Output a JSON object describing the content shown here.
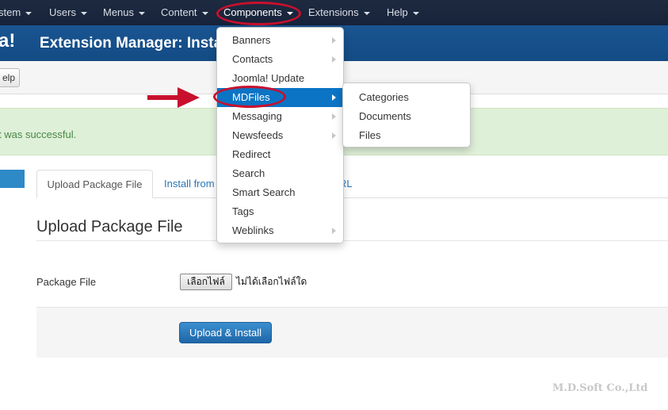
{
  "nav": {
    "items": [
      {
        "label": "stem"
      },
      {
        "label": "Users"
      },
      {
        "label": "Menus"
      },
      {
        "label": "Content"
      },
      {
        "label": "Components"
      },
      {
        "label": "Extensions"
      },
      {
        "label": "Help"
      }
    ]
  },
  "header": {
    "logo": "a!",
    "title": "Extension Manager: Insta"
  },
  "toolbar": {
    "help_label": "elp"
  },
  "alert": {
    "message": "t was successful."
  },
  "tabs": {
    "upload_label": "Upload Package File",
    "install_from_label": "Install from",
    "url_label": "RL"
  },
  "section": {
    "title": "Upload Package File",
    "package_label": "Package File",
    "file_button": "เลือกไฟล์",
    "file_status": "ไม่ได้เลือกไฟล์ใด",
    "submit_label": "Upload & Install"
  },
  "dropdown": {
    "items": [
      {
        "label": "Banners",
        "submenu": true
      },
      {
        "label": "Contacts",
        "submenu": true
      },
      {
        "label": "Joomla! Update",
        "submenu": false
      },
      {
        "label": "MDFiles",
        "submenu": true,
        "highlighted": true
      },
      {
        "label": "Messaging",
        "submenu": true
      },
      {
        "label": "Newsfeeds",
        "submenu": true
      },
      {
        "label": "Redirect",
        "submenu": false
      },
      {
        "label": "Search",
        "submenu": false
      },
      {
        "label": "Smart Search",
        "submenu": false
      },
      {
        "label": "Tags",
        "submenu": false
      },
      {
        "label": "Weblinks",
        "submenu": true
      }
    ]
  },
  "submenu": {
    "items": [
      {
        "label": "Categories"
      },
      {
        "label": "Documents"
      },
      {
        "label": "Files"
      }
    ]
  },
  "watermark": "M.D.Soft Co.,Ltd",
  "colors": {
    "nav_bg": "#1d2a40",
    "header_bg": "#1a5592",
    "highlight": "#0b74c5",
    "annotation_red": "#c8102e",
    "alert_bg": "#dff0d8"
  }
}
